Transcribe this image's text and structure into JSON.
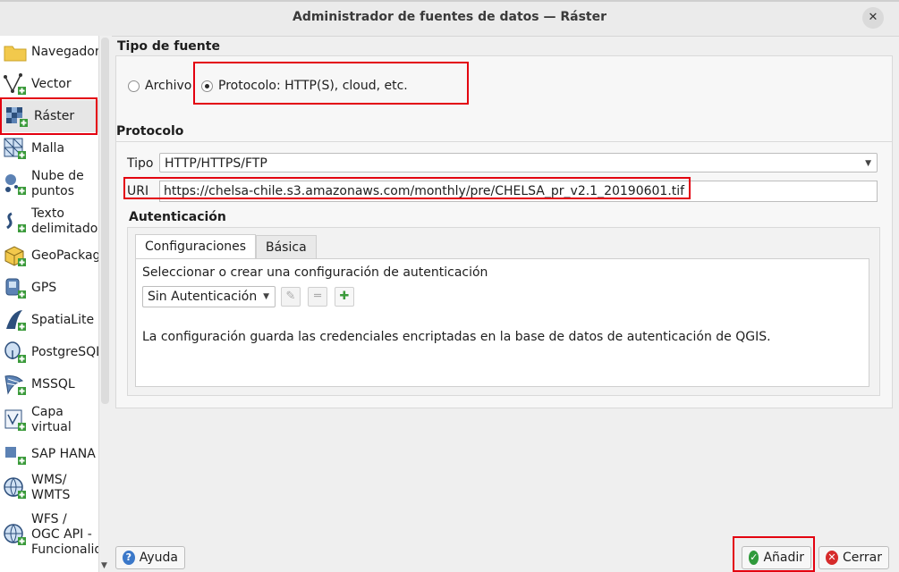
{
  "window": {
    "title": "Administrador de fuentes de datos — Ráster",
    "close_glyph": "✕"
  },
  "sidebar": {
    "items": [
      {
        "label": "Navegador",
        "icon": "folder-icon"
      },
      {
        "label": "Vector",
        "icon": "vector-icon"
      },
      {
        "label": "Ráster",
        "icon": "raster-icon",
        "selected": true
      },
      {
        "label": "Malla",
        "icon": "mesh-icon"
      },
      {
        "label": "Nube de\npuntos",
        "icon": "point-cloud-icon"
      },
      {
        "label": "Texto\ndelimitado",
        "icon": "delimited-text-icon"
      },
      {
        "label": "GeoPackage",
        "icon": "geopackage-icon"
      },
      {
        "label": "GPS",
        "icon": "gps-icon"
      },
      {
        "label": "SpatiaLite",
        "icon": "spatialite-icon"
      },
      {
        "label": "PostgreSQL",
        "icon": "postgresql-icon"
      },
      {
        "label": "MSSQL",
        "icon": "mssql-icon"
      },
      {
        "label": "Capa\nvirtual",
        "icon": "virtual-layer-icon"
      },
      {
        "label": "SAP HANA",
        "icon": "sap-hana-icon"
      },
      {
        "label": "WMS/\nWMTS",
        "icon": "wms-icon"
      },
      {
        "label": "WFS /\nOGC API -\nFuncionalid",
        "icon": "wfs-icon"
      }
    ]
  },
  "source_type": {
    "title": "Tipo de fuente",
    "options": [
      {
        "label": "Archivo",
        "checked": false
      },
      {
        "label": "Protocolo: HTTP(S), cloud, etc.",
        "checked": true
      }
    ]
  },
  "protocol": {
    "title": "Protocolo",
    "type_label": "Tipo",
    "type_value": "HTTP/HTTPS/FTP",
    "uri_label": "URI",
    "uri_value": "https://chelsa-chile.s3.amazonaws.com/monthly/pre/CHELSA_pr_v2.1_20190601.tif"
  },
  "auth": {
    "title": "Autenticación",
    "tabs": [
      {
        "label": "Configuraciones",
        "active": true
      },
      {
        "label": "Básica",
        "active": false
      }
    ],
    "select_label": "Seleccionar o crear una configuración de autenticación",
    "config_value": "Sin Autenticación",
    "info_text": "La configuración guarda las credenciales encriptadas en la base de datos de autenticación de QGIS."
  },
  "buttons": {
    "help": "Ayuda",
    "add": "Añadir",
    "close": "Cerrar"
  },
  "colors": {
    "highlight": "#e3000f",
    "selected_bg": "#e6e6e6"
  }
}
